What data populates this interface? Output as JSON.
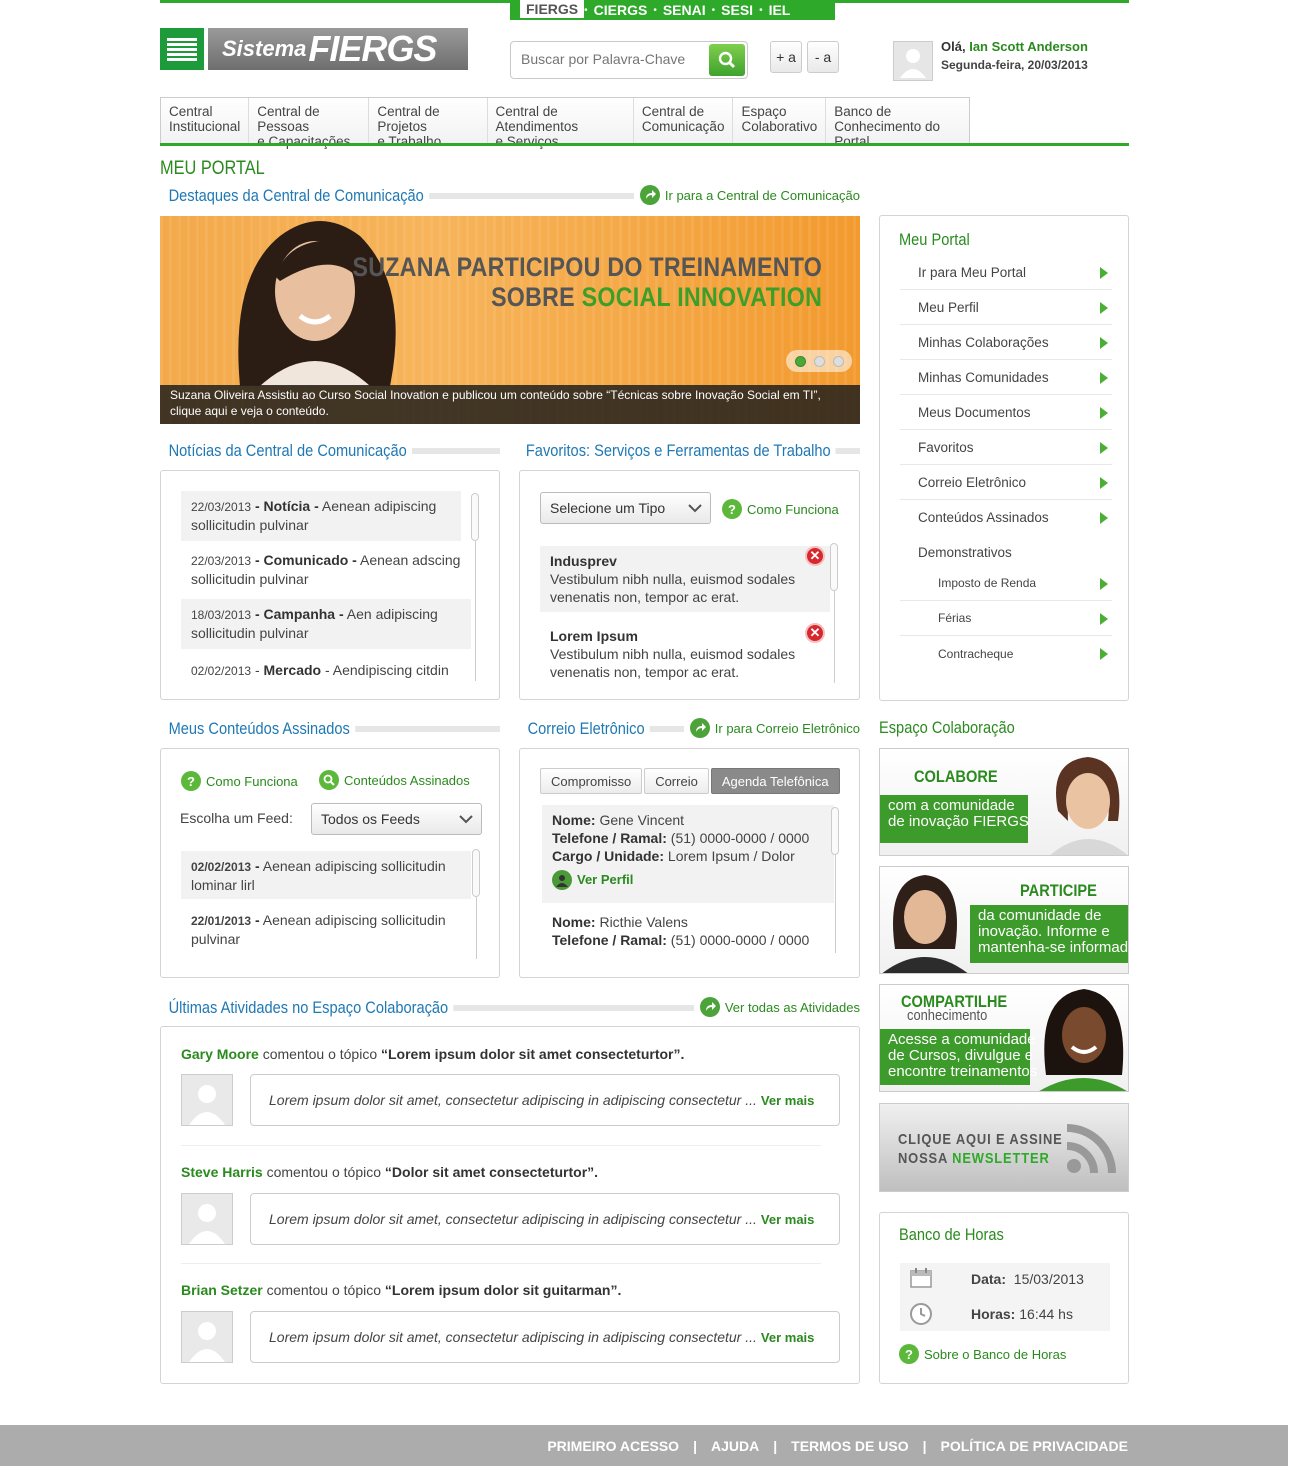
{
  "topbar": {
    "items": [
      "FIERGS",
      "CIERGS",
      "SENAI",
      "SESI",
      "IEL"
    ]
  },
  "logo": {
    "prefix": "Sistema",
    "name": "FIERGS"
  },
  "search": {
    "placeholder": "Buscar por Palavra-Chave"
  },
  "font_controls": {
    "increase": "+ a",
    "decrease": "- a"
  },
  "user": {
    "greeting": "Olá,",
    "name": "Ian Scott Anderson",
    "date": "Segunda-feira, 20/03/2013"
  },
  "nav": [
    {
      "l1": "Central",
      "l2": "Institucional"
    },
    {
      "l1": "Central de Pessoas",
      "l2": "e Capacitações"
    },
    {
      "l1": "Central de Projetos",
      "l2": "e Trabalho"
    },
    {
      "l1": "Central de Atendimentos",
      "l2": "e Serviços"
    },
    {
      "l1": "Central de",
      "l2": "Comunicação"
    },
    {
      "l1": "Espaço",
      "l2": "Colaborativo"
    },
    {
      "l1": "Banco de",
      "l2": "Conhecimento do Portal"
    }
  ],
  "page_title": "MEU PORTAL",
  "destaques": {
    "title": "Destaques da Central de Comunicação",
    "link": "Ir para a Central de Comunicação"
  },
  "banner": {
    "line1": "SUZANA PARTICIPOU DO TREINAMENTO",
    "line2a": "SOBRE ",
    "line2b": "SOCIAL INNOVATION",
    "caption1": "Suzana Oliveira Assistiu ao Curso Social Inovation e publicou um conteúdo sobre “Técnicas sobre Inovação Social em TI”,",
    "caption2": "clique aqui e veja  o conteúdo."
  },
  "noticias": {
    "title": "Notícias da Central de Comunicação",
    "items": [
      {
        "date": "22/03/2013",
        "type": "Notícia",
        "text": "Aenean adipiscing",
        "text2": "sollicitudin pulvinar"
      },
      {
        "date": "22/03/2013",
        "type": "Comunicado",
        "text": "Aenean adscing",
        "text2": "sollicitudin pulvinar"
      },
      {
        "date": "18/03/2013",
        "type": "Campanha",
        "text": "Aen adipiscing",
        "text2": "sollicitudin pulvinar"
      },
      {
        "date": "02/02/2013",
        "type": "Mercado",
        "text": "Aendipiscing citdin",
        "text2": ""
      }
    ]
  },
  "favoritos": {
    "title": "Favoritos: Serviços e Ferramentas de Trabalho",
    "select": "Selecione um Tipo",
    "help": "Como Funciona",
    "items": [
      {
        "name": "Indusprev",
        "line1": "Vestibulum nibh nulla, euismod sodales",
        "line2": "venenatis non, tempor ac erat."
      },
      {
        "name": "Lorem Ipsum",
        "line1": "Vestibulum nibh nulla, euismod sodales",
        "line2": "venenatis non, tempor ac erat."
      }
    ]
  },
  "conteudos": {
    "title": "Meus Conteúdos Assinados",
    "help": "Como Funciona",
    "link": "Conteúdos Assinados",
    "feed_label": "Escolha um Feed:",
    "feed_value": "Todos os Feeds",
    "items": [
      {
        "date": "02/02/2013",
        "text": "Aenean adipiscing sollicitudin",
        "text2": "lominar lirl"
      },
      {
        "date": "22/01/2013",
        "text": " Aenean adipiscing sollicitudin",
        "text2": "pulvinar"
      }
    ]
  },
  "correio": {
    "title": "Correio Eletrônico",
    "link": "Ir para Correio Eletrônico",
    "tabs": [
      "Compromisso",
      "Correio",
      "Agenda Telefônica"
    ],
    "contacts": [
      {
        "nome_l": "Nome:",
        "nome": "Gene Vincent",
        "tel_l": "Telefone / Ramal:",
        "tel": "(51) 0000-0000 / 0000",
        "cargo_l": "Cargo / Unidade:",
        "cargo": "Lorem Ipsum / Dolor",
        "perfil": "Ver Perfil"
      },
      {
        "nome_l": "Nome:",
        "nome": "Ricthie Valens",
        "tel_l": "Telefone / Ramal:",
        "tel": "(51) 0000-0000 / 0000"
      }
    ]
  },
  "atividades": {
    "title": "Últimas Atividades no Espaço Colaboração",
    "link": "Ver todas as Atividades",
    "verb": "comentou o tópico",
    "more": "Ver mais",
    "items": [
      {
        "user": "Gary Moore",
        "topic": "“Lorem ipsum dolor sit amet consecteturtor”.",
        "comment": "Lorem ipsum dolor sit amet, consectetur adipiscing  in adipiscing consectetur ..."
      },
      {
        "user": "Steve Harris",
        "topic": "“Dolor sit amet consecteturtor”.",
        "comment": "Lorem ipsum dolor sit amet, consectetur adipiscing  in adipiscing consectetur ..."
      },
      {
        "user": "Brian Setzer",
        "topic": "“Lorem ipsum dolor sit guitarman”.",
        "comment": "Lorem ipsum dolor sit amet, consectetur adipiscing  in adipiscing consectetur ..."
      }
    ]
  },
  "side_menu": {
    "title": "Meu Portal",
    "items": [
      "Ir para Meu Portal",
      "Meu Perfil",
      "Minhas Colaborações",
      "Minhas Comunidades",
      "Meus Documentos",
      "Favoritos",
      "Correio Eletrônico",
      "Conteúdos Assinados"
    ],
    "group": "Demonstrativos",
    "subitems": [
      "Imposto de Renda",
      "Férias",
      "Contracheque"
    ]
  },
  "colab": {
    "title": "Espaço Colaboração",
    "colabore": {
      "title": "COLABORE",
      "l1": "com a comunidade",
      "l2": "de inovação FIERGS"
    },
    "participe": {
      "title": "PARTICIPE",
      "l1": "da comunidade de",
      "l2": "inovação. Informe e",
      "l3": "mantenha-se informado"
    },
    "compartilhe": {
      "title": "COMPARTILHE",
      "sub": "conhecimento",
      "l1": "Acesse a comunidade",
      "l2": "de Cursos, divulgue e",
      "l3": "encontre treinamentos"
    },
    "newsletter": {
      "l1": "CLIQUE AQUI E ASSINE",
      "l2a": "NOSSA",
      "l2b": "NEWSLETTER"
    }
  },
  "banco": {
    "title": "Banco de Horas",
    "data_l": "Data:",
    "data": "15/03/2013",
    "horas_l": "Horas:",
    "horas": "16:44 hs",
    "link": "Sobre o Banco de Horas"
  },
  "footer": {
    "items": [
      "PRIMEIRO ACESSO",
      "AJUDA",
      "TERMOS DE USO",
      "POLÍTICA DE PRIVACIDADE"
    ],
    "sep": "|"
  },
  "colors": {
    "green": "#2ea92a",
    "blue": "#1e78b4",
    "orange": "#f3a94a"
  }
}
